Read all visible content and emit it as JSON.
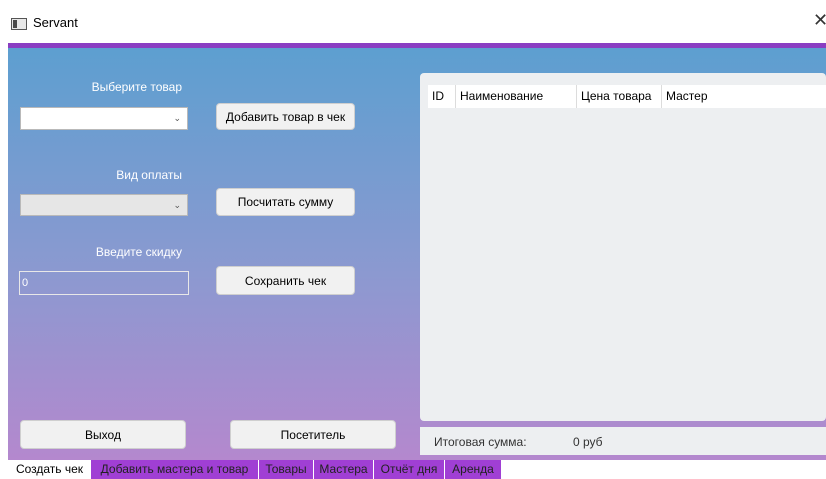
{
  "window": {
    "title": "Servant"
  },
  "colors": {
    "accent": "#8a3ec2",
    "tab_bg": "#a03fd4",
    "gradient_top": "#5d9fd0",
    "gradient_bottom": "#b488ce"
  },
  "form": {
    "select_product_label": "Выберите товар",
    "select_product_value": "",
    "add_product_button": "Добавить товар в чек",
    "payment_type_label": "Вид оплаты",
    "payment_type_value": "",
    "calc_sum_button": "Посчитать сумму",
    "discount_label": "Введите скидку",
    "discount_value": "0",
    "save_check_button": "Сохранить чек",
    "exit_button": "Выход",
    "visitor_button": "Посетитель"
  },
  "table": {
    "columns": [
      "ID",
      "Наименование",
      "Цена товара",
      "Мастер"
    ],
    "rows": []
  },
  "status": {
    "total_label": "Итоговая сумма:",
    "total_value": "0 руб"
  },
  "tabs": [
    "Создать чек",
    "Добавить мастера и товар",
    "Товары",
    "Мастера",
    "Отчёт дня",
    "Аренда"
  ]
}
